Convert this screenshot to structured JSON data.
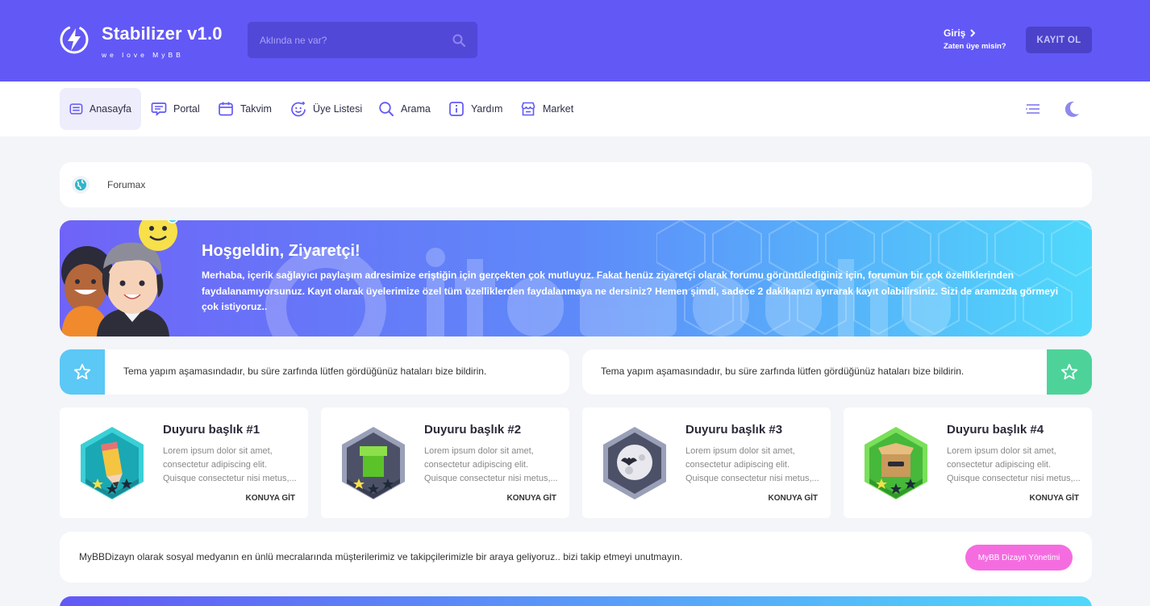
{
  "header": {
    "logo_title": "Stabilizer v1.0",
    "logo_subtitle": "we love MyBB",
    "search_placeholder": "Aklında ne var?",
    "login_label": "Giriş",
    "login_sub": "Zaten üye misin?",
    "register_label": "KAYIT OL"
  },
  "nav": {
    "items": [
      {
        "label": "Anasayfa",
        "icon": "home-card-icon",
        "active": true
      },
      {
        "label": "Portal",
        "icon": "portal-chat-icon"
      },
      {
        "label": "Takvim",
        "icon": "calendar-icon"
      },
      {
        "label": "Üye Listesi",
        "icon": "smiley-icon"
      },
      {
        "label": "Arama",
        "icon": "search-icon"
      },
      {
        "label": "Yardım",
        "icon": "info-icon"
      },
      {
        "label": "Market",
        "icon": "store-icon"
      }
    ],
    "right_icons": [
      "menu-lines-icon",
      "moon-icon"
    ]
  },
  "breadcrumb": {
    "text": "Forumax",
    "icon": "globe-icon"
  },
  "welcome": {
    "title": "Hoşgeldin, Ziyaretçi!",
    "text": "Merhaba, içerik sağlayıcı paylaşım adresimize eriştiğin için gerçekten çok mutluyuz. Fakat henüz ziyaretçi olarak forumu görüntülediğiniz için, forumun bir çok özelliklerinden faydalanamıyorsunuz. Kayıt olarak üyelerimize özel tüm özelliklerden faydalanmaya ne dersiniz? Hemen şimdi, sadece 2 dakikanızı ayırarak kayıt olabilirsiniz. Sizi de aramızda görmeyi çok istiyoruz.."
  },
  "notices": [
    {
      "text": "Tema yapım aşamasındadır, bu süre zarfında lütfen gördüğünüz hataları bize bildirin.",
      "icon": "star-icon",
      "color": "#5bc8f5"
    },
    {
      "text": "Tema yapım aşamasındadır, bu süre zarfında lütfen gördüğünüz hataları bize bildirin.",
      "icon": "star-icon",
      "color": "#4dd39a"
    }
  ],
  "announcements": [
    {
      "title": "Duyuru başlık #1",
      "desc": "Lorem ipsum dolor sit amet, consectetur adipiscing elit. Quisque consectetur nisi metus,...",
      "link": "KONUYA GİT",
      "badge": "pencil-badge-icon"
    },
    {
      "title": "Duyuru başlık #2",
      "desc": "Lorem ipsum dolor sit amet, consectetur adipiscing elit. Quisque consectetur nisi metus,...",
      "link": "KONUYA GİT",
      "badge": "pipe-badge-icon"
    },
    {
      "title": "Duyuru başlık #3",
      "desc": "Lorem ipsum dolor sit amet, consectetur adipiscing elit. Quisque consectetur nisi metus,...",
      "link": "KONUYA GİT",
      "badge": "moon-bat-badge-icon"
    },
    {
      "title": "Duyuru başlık #4",
      "desc": "Lorem ipsum dolor sit amet, consectetur adipiscing elit. Quisque consectetur nisi metus,...",
      "link": "KONUYA GİT",
      "badge": "box-badge-icon"
    }
  ],
  "social": {
    "text": "MyBBDizayn olarak sosyal medyanın en ünlü mecralarında müşterilerimiz ve takipçilerimizle bir araya geliyoruz.. bizi takip etmeyi unutmayın.",
    "button": "MyBB Dizayn Yönetimi"
  },
  "colors": {
    "brand": "#6258f6",
    "accent_cyan": "#4fd9fb",
    "pink": "#f56ce0"
  }
}
